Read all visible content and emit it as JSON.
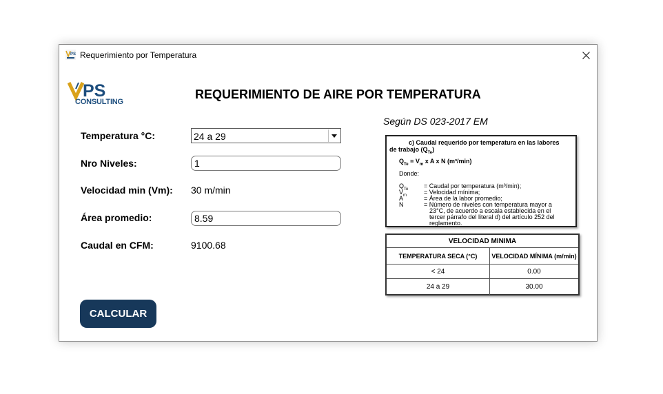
{
  "window": {
    "title": "Requerimiento por Temperatura"
  },
  "brand": {
    "logo_text": "CONSULTING",
    "logo_mark": "VPS"
  },
  "heading": "REQUERIMIENTO DE AIRE POR TEMPERATURA",
  "form": {
    "temperatura_label": "Temperatura °C:",
    "temperatura_value": "24 a 29",
    "niveles_label": "Nro Niveles:",
    "niveles_value": "1",
    "velocidad_label": "Velocidad min (Vm):",
    "velocidad_value": "30 m/min",
    "area_label": "Área promedio:",
    "area_value": "8.59",
    "caudal_label": "Caudal en CFM:",
    "caudal_value": "9100.68",
    "calcular_label": "CALCULAR"
  },
  "reference": {
    "segun": "Según DS 023-2017 EM",
    "box_title_1": "c) Caudal requerido por temperatura en las labores",
    "box_title_2": "de trabajo (Q",
    "box_title_sub": "Te",
    "box_title_end": ")",
    "formula": "Q",
    "formula_sub": "Te",
    "formula_rest": " = V",
    "formula_sub2": "m",
    "formula_end": " x A x N (m³/min)",
    "donde": "Donde:",
    "defs": [
      {
        "sym": "Q",
        "sub": "Te",
        "text": "= Caudal por temperatura (m³/min);"
      },
      {
        "sym": "V",
        "sub": "m",
        "text": "= Velocidad mínima;"
      },
      {
        "sym": "A",
        "sub": "",
        "text": "= Área de la labor promedio;"
      },
      {
        "sym": "N",
        "sub": "",
        "text": "= Número de niveles con temperatura mayor a"
      }
    ],
    "defs_cont": [
      "23°C, de acuerdo a escala establecida en el",
      "tercer párrafo del literal d) del artículo 252 del",
      "reglamento."
    ],
    "table": {
      "title": "VELOCIDAD MINIMA",
      "col1": "TEMPERATURA SECA (°C)",
      "col2": "VELOCIDAD MÍNIMA (m/min)",
      "rows": [
        {
          "t": "< 24",
          "v": "0.00"
        },
        {
          "t": "24 a 29",
          "v": "30.00"
        }
      ]
    }
  }
}
